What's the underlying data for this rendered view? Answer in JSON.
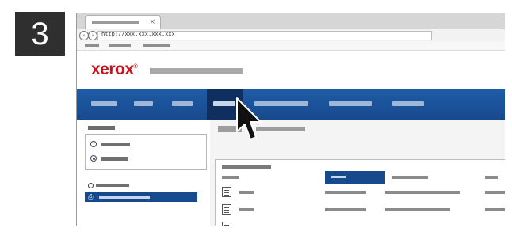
{
  "step": {
    "number": "3"
  },
  "browser": {
    "tab_close": "×",
    "url": "http://xxx.xxx.xxx.xxx"
  },
  "site": {
    "logo": "xerox",
    "logo_mark": "®"
  },
  "colors": {
    "brand_red": "#c8141e",
    "nav_blue": "#1f5ca8",
    "nav_active": "#0e2f60",
    "selection_blue": "#174a8c"
  },
  "icons": {
    "tab_close": "close-icon",
    "back": "back-arrow-icon",
    "forward": "forward-arrow-icon",
    "cursor": "mouse-pointer-icon",
    "row": "document-icon",
    "sidebar_selected": "printer-icon"
  },
  "navbar": {
    "active_index": 3
  },
  "sidebar": {
    "radio_selected_index": 1
  },
  "table": {
    "visible_rows": 2
  }
}
